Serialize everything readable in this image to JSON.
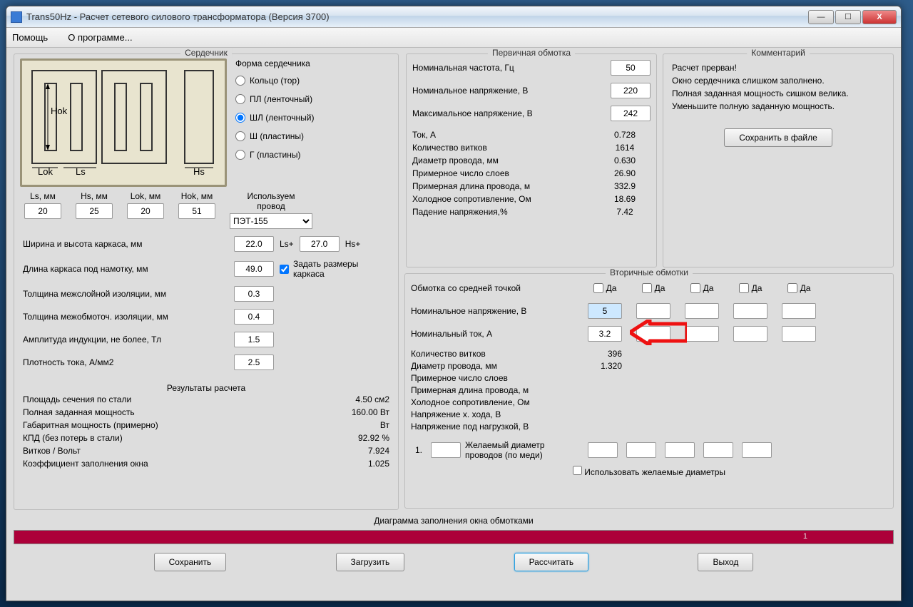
{
  "window": {
    "title": "Trans50Hz - Расчет сетевого силового трансформатора (Версия 3700)"
  },
  "menu": {
    "help": "Помощь",
    "about": "О программе..."
  },
  "core": {
    "legend": "Сердечник",
    "shape_label": "Форма сердечника",
    "shapes": {
      "ring": "Кольцо (тор)",
      "pl": "ПЛ (ленточный)",
      "shl": "ШЛ (ленточный)",
      "sh": "Ш  (пластины)",
      "g": "Г (пластины)"
    },
    "dims": {
      "ls": {
        "label": "Ls, мм",
        "value": "20"
      },
      "hs": {
        "label": "Hs, мм",
        "value": "25"
      },
      "lok": {
        "label": "Lok, мм",
        "value": "20"
      },
      "hok": {
        "label": "Hok, мм",
        "value": "51"
      }
    },
    "wire_label": "Используем\nпровод",
    "wire_value": "ПЭТ-155",
    "frame_wh": {
      "label": "Ширина и высота каркаса, мм",
      "w": "22.0",
      "wtag": "Ls+",
      "h": "27.0",
      "htag": "Hs+"
    },
    "frame_len": {
      "label": "Длина каркаса под намотку, мм",
      "value": "49.0"
    },
    "set_frame_cb": "Задать размеры каркаса",
    "interlayer": {
      "label": "Толщина межслойной изоляции, мм",
      "value": "0.3"
    },
    "interwind": {
      "label": "Толщина межобмоточ. изоляции, мм",
      "value": "0.4"
    },
    "induction": {
      "label": "Амплитуда индукции, не более, Тл",
      "value": "1.5"
    },
    "jdensity": {
      "label": "Плотность тока, А/мм2",
      "value": "2.5"
    },
    "results_label": "Результаты расчета",
    "res": [
      {
        "l": "Площадь сечения по стали",
        "v": "4.50 см2"
      },
      {
        "l": "Полная заданная мощность",
        "v": "160.00 Вт"
      },
      {
        "l": "Габаритная мощность (примерно)",
        "v": "Вт"
      },
      {
        "l": "КПД (без потерь в стали)",
        "v": "92.92 %"
      },
      {
        "l": "Витков / Вольт",
        "v": "7.924"
      },
      {
        "l": "Коэффициент заполнения окна",
        "v": "1.025"
      }
    ]
  },
  "primary": {
    "legend": "Первичная обмотка",
    "freq": {
      "label": "Номинальная частота, Гц",
      "value": "50"
    },
    "unom": {
      "label": "Номинальное напряжение, В",
      "value": "220"
    },
    "umax": {
      "label": "Максимальное напряжение, В",
      "value": "242"
    },
    "res": [
      {
        "l": "Ток, А",
        "v": "0.728"
      },
      {
        "l": "Количество витков",
        "v": "1614"
      },
      {
        "l": "Диаметр провода, мм",
        "v": "0.630"
      },
      {
        "l": "Примерное число слоев",
        "v": "26.90"
      },
      {
        "l": "Примерная длина провода, м",
        "v": "332.9"
      },
      {
        "l": "Холодное сопротивление, Ом",
        "v": "18.69"
      },
      {
        "l": "Падение напряжения,%",
        "v": "7.42"
      }
    ]
  },
  "comment": {
    "legend": "Комментарий",
    "text": "Расчет прерван!\nОкно сердечника слишком заполнено.\nПолная заданная мощность сишком велика.\nУменьшите полную заданную мощность.",
    "save_btn": "Сохранить в файле"
  },
  "secondary": {
    "legend": "Вторичные обмотки",
    "midpoint_label": "Обмотка со средней точкой",
    "yes": "Да",
    "unom_label": "Номинальное напряжение, В",
    "inom_label": "Номинальный ток, А",
    "cols": [
      {
        "unom": "5",
        "inom": "3.2"
      },
      {
        "unom": "",
        "inom": ""
      },
      {
        "unom": "",
        "inom": ""
      },
      {
        "unom": "",
        "inom": ""
      },
      {
        "unom": "",
        "inom": ""
      }
    ],
    "res": [
      {
        "l": "Количество витков",
        "v": "396"
      },
      {
        "l": "Диаметр провода, мм",
        "v": "1.320"
      },
      {
        "l": "Примерное число слоев",
        "v": ""
      },
      {
        "l": "Примерная длина провода, м",
        "v": ""
      },
      {
        "l": "Холодное сопротивление, Ом",
        "v": ""
      },
      {
        "l": "Напряжение х. хода, В",
        "v": ""
      },
      {
        "l": "Напряжение под нагрузкой, В",
        "v": ""
      }
    ],
    "desired_num": "1.",
    "desired_label": "Желаемый диаметр проводов  (по меди)",
    "use_desired": "Использовать желаемые диаметры"
  },
  "diagram_label": "Диаграмма заполнения окна обмотками",
  "diagram_mark": "1",
  "footer": {
    "save": "Сохранить",
    "load": "Загрузить",
    "calc": "Рассчитать",
    "exit": "Выход"
  }
}
